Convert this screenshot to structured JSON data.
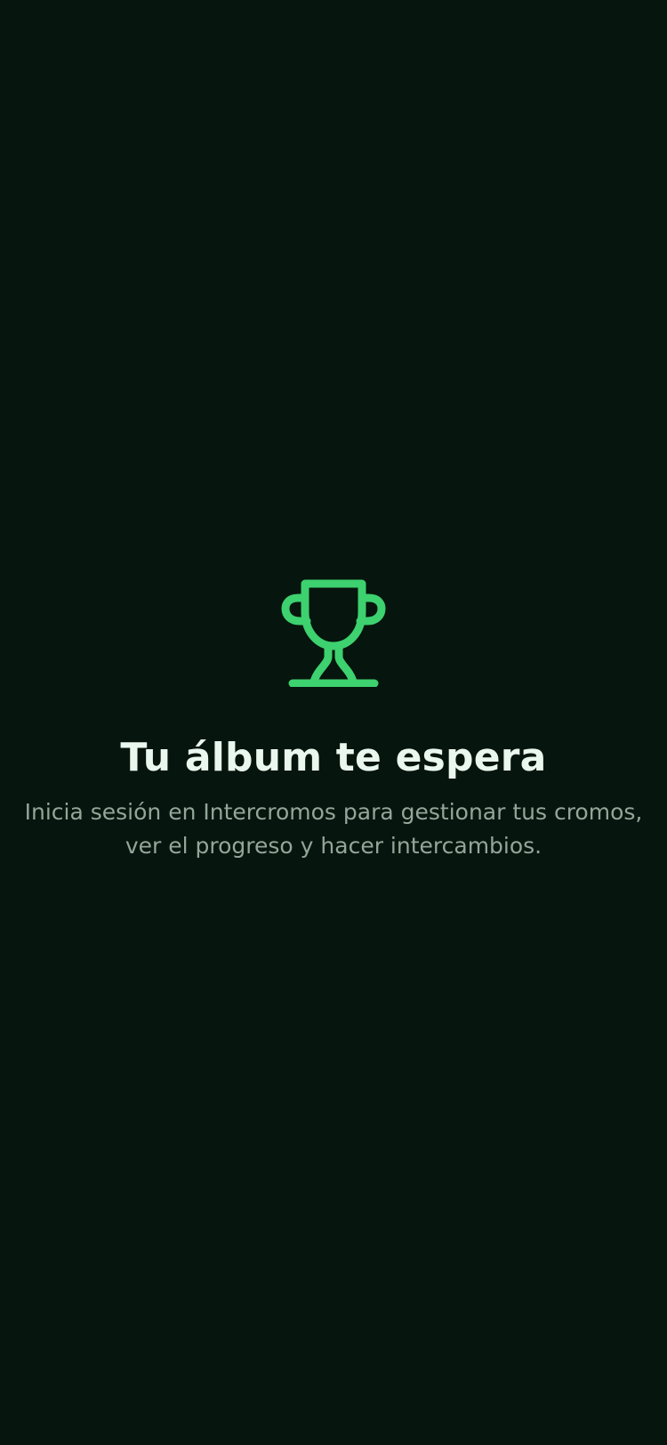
{
  "colors": {
    "background": "#06150d",
    "accent": "#3dd16f",
    "title": "#eaf7ee",
    "message": "#93a69a"
  },
  "empty_state": {
    "icon": "trophy-icon",
    "title": "Tu álbum te espera",
    "message": "Inicia sesión en Intercromos para gestionar tus cromos, ver el progreso y hacer intercambios."
  }
}
